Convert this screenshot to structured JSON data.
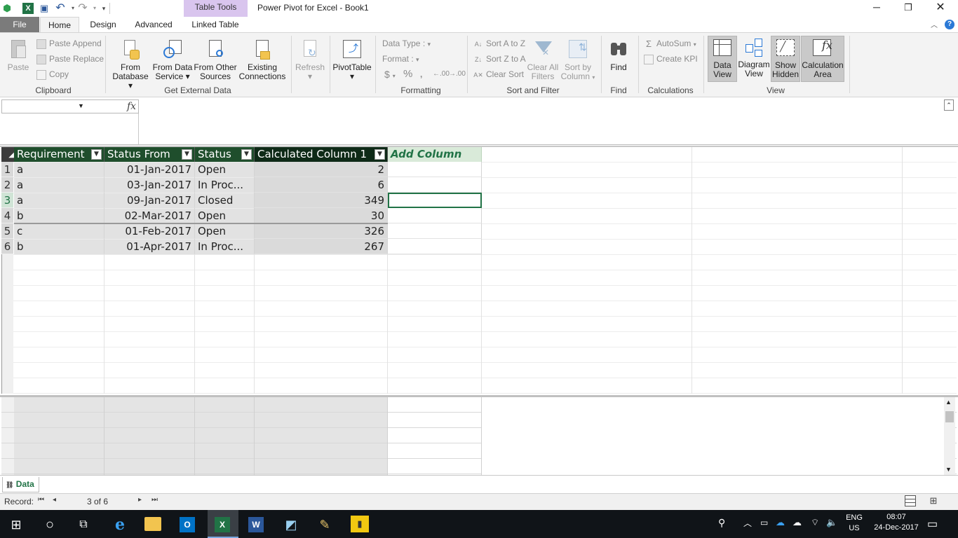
{
  "window": {
    "title": "Power Pivot for Excel - Book1",
    "context_tab_group": "Table Tools"
  },
  "tabs": [
    {
      "label": "File"
    },
    {
      "label": "Home"
    },
    {
      "label": "Design"
    },
    {
      "label": "Advanced"
    },
    {
      "label": "Linked Table"
    }
  ],
  "ribbon": {
    "clipboard": {
      "label": "Clipboard",
      "paste": "Paste",
      "paste_append": "Paste Append",
      "paste_replace": "Paste Replace",
      "copy": "Copy"
    },
    "external": {
      "label": "Get External Data",
      "from_database": [
        "From",
        "Database"
      ],
      "from_data_service": [
        "From Data",
        "Service"
      ],
      "from_other_sources": [
        "From Other",
        "Sources"
      ],
      "existing_connections": [
        "Existing",
        "Connections"
      ]
    },
    "refresh": "Refresh",
    "pivottable": "PivotTable",
    "formatting": {
      "label": "Formatting",
      "data_type": "Data Type :",
      "format": "Format :",
      "currency": "$",
      "percent": "%",
      "comma": "9",
      "inc_dec": ".00",
      "dec_dec": ".00"
    },
    "sort": {
      "label": "Sort and Filter",
      "sort_az": "Sort A to Z",
      "sort_za": "Sort Z to A",
      "clear_sort": "Clear Sort",
      "clear_filters": [
        "Clear All",
        "Filters"
      ],
      "sort_by_column": [
        "Sort by",
        "Column"
      ]
    },
    "find": {
      "label": "Find",
      "button": "Find"
    },
    "calculations": {
      "label": "Calculations",
      "autosum": "AutoSum",
      "create_kpi": "Create KPI"
    },
    "view": {
      "label": "View",
      "data_view": [
        "Data",
        "View"
      ],
      "diagram_view": [
        "Diagram",
        "View"
      ],
      "show_hidden": [
        "Show",
        "Hidden"
      ],
      "calculation_area": [
        "Calculation",
        "Area"
      ]
    }
  },
  "formula_bar": {
    "name_box": "",
    "fx": "fx",
    "formula": ""
  },
  "table": {
    "columns": [
      "Requirement",
      "Status From",
      "Status",
      "Calculated Column 1"
    ],
    "add_column": "Add Column",
    "rows": [
      {
        "n": "1",
        "req": "a",
        "from": "01-Jan-2017",
        "status": "Open",
        "calc": "2"
      },
      {
        "n": "2",
        "req": "a",
        "from": "03-Jan-2017",
        "status": "In Proc...",
        "calc": "6"
      },
      {
        "n": "3",
        "req": "a",
        "from": "09-Jan-2017",
        "status": "Closed",
        "calc": "349"
      },
      {
        "n": "4",
        "req": "b",
        "from": "02-Mar-2017",
        "status": "Open",
        "calc": "30"
      },
      {
        "n": "5",
        "req": "c",
        "from": "01-Feb-2017",
        "status": "Open",
        "calc": "326"
      },
      {
        "n": "6",
        "req": "b",
        "from": "01-Apr-2017",
        "status": "In Proc...",
        "calc": "267"
      }
    ]
  },
  "sheet_tab": "Data",
  "status": {
    "record_label": "Record:",
    "record_value": "3 of 6"
  },
  "taskbar": {
    "lang1": "ENG",
    "lang2": "US",
    "time": "08:07",
    "date": "24-Dec-2017"
  },
  "colors": {
    "header_bg": "#1f4e2c",
    "accent_green": "#217346",
    "context_tab": "#d9c5ee"
  }
}
